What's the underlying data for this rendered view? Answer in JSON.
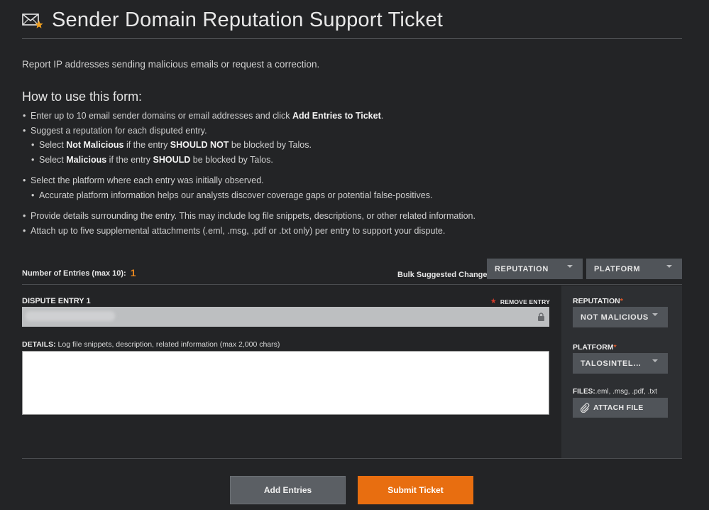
{
  "header": {
    "title": "Sender Domain Reputation Support Ticket",
    "icon": "mail-star-icon"
  },
  "intro": "Report IP addresses sending malicious emails or request a correction.",
  "howto": {
    "title": "How to use this form:",
    "b1_pre": "Enter up to 10 email sender domains or email addresses and click ",
    "b1_bold": "Add Entries to Ticket",
    "b1_post": ".",
    "b2": "Suggest a reputation for each disputed entry.",
    "b2a_pre": "Select ",
    "b2a_bold1": "Not Malicious",
    "b2a_mid": " if the entry ",
    "b2a_bold2": "SHOULD NOT",
    "b2a_post": " be blocked by Talos.",
    "b2b_pre": "Select ",
    "b2b_bold1": "Malicious",
    "b2b_mid": " if the entry ",
    "b2b_bold2": "SHOULD",
    "b2b_post": " be blocked by Talos.",
    "b3": "Select the platform where each entry was initially observed.",
    "b3a": "Accurate platform information helps our analysts discover coverage gaps or potential false-positives.",
    "b4": "Provide details surrounding the entry. This may include log file snippets, descriptions, or other related information.",
    "b5": "Attach up to five supplemental attachments (.eml, .msg, .pdf or .txt only) per entry to support your dispute."
  },
  "entries": {
    "count_label": "Number of Entries (max 10):",
    "count": "1",
    "bulk_label": "Bulk Suggested Changes:",
    "bulk_reputation": "REPUTATION",
    "bulk_platform": "PLATFORM"
  },
  "entry": {
    "title": "DISPUTE ENTRY 1",
    "remove": "REMOVE ENTRY",
    "details_label_bold": "DETAILS:",
    "details_label": " Log file snippets, description, related information (max 2,000 chars)",
    "details_value": ""
  },
  "side": {
    "reputation_label": "REPUTATION",
    "reputation_value": "NOT MALICIOUS",
    "platform_label": "PLATFORM",
    "platform_value": "TALOSINTELLIGENCE",
    "files_label_bold": "FILES:",
    "files_label": ".eml, .msg, .pdf, .txt",
    "attach": "ATTACH FILE"
  },
  "actions": {
    "add": "Add Entries",
    "submit": "Submit Ticket"
  },
  "colors": {
    "accent": "#e86e10",
    "count": "#e8871e",
    "required": "#e05a2a"
  }
}
